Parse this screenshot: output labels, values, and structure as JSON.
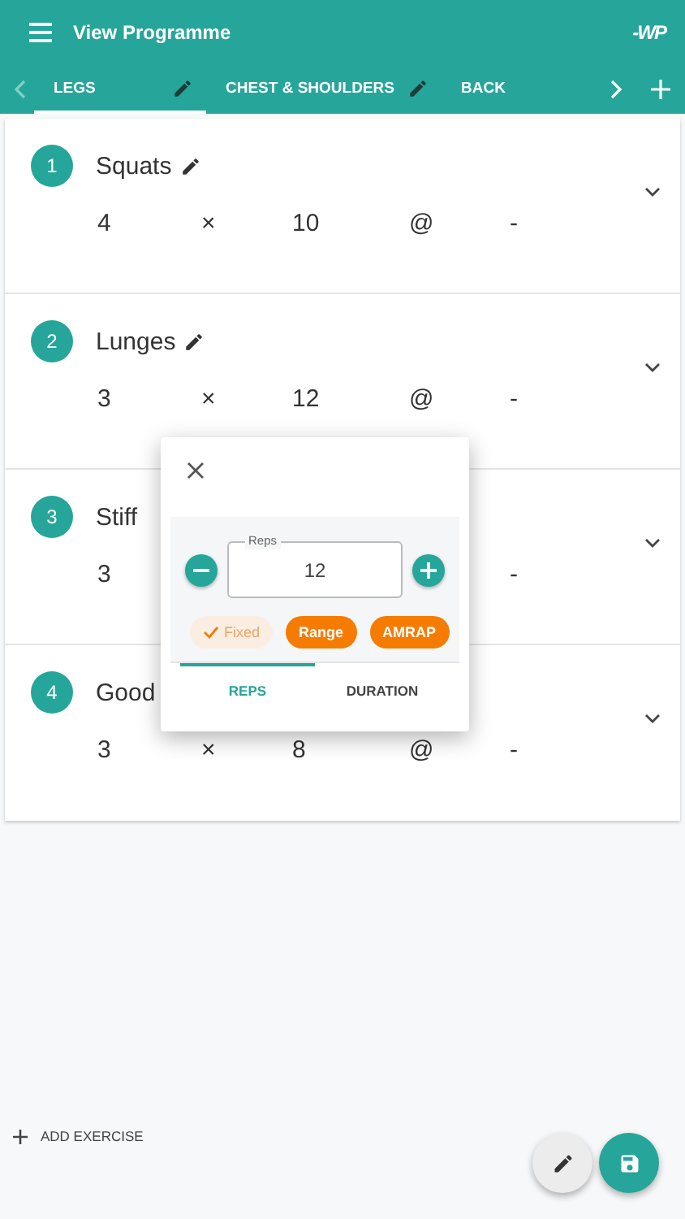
{
  "app_bar": {
    "title": "View Programme",
    "logo": "-WP"
  },
  "tabs": [
    {
      "label": "LEGS",
      "selected": true,
      "editable": true
    },
    {
      "label": "CHEST & SHOULDERS",
      "selected": false,
      "editable": true
    },
    {
      "label": "BACK",
      "selected": false,
      "editable": false
    }
  ],
  "exercises": [
    {
      "number": "1",
      "name": "Squats",
      "edit_icon": true,
      "sets": "4",
      "times": "×",
      "reps": "10",
      "at": "@",
      "weight": "-"
    },
    {
      "number": "2",
      "name": "Lunges",
      "edit_icon": true,
      "sets": "3",
      "times": "×",
      "reps": "12",
      "at": "@",
      "weight": "-"
    },
    {
      "number": "3",
      "name": "Stiff",
      "edit_icon": false,
      "sets": "3",
      "weight": "-"
    },
    {
      "number": "4",
      "name": "Good",
      "edit_icon": false,
      "sets": "3",
      "times": "×",
      "reps": "8",
      "at": "@",
      "weight": "-"
    }
  ],
  "dialog": {
    "field_label": "Reps",
    "field_value": "12",
    "modes": [
      {
        "label": "Fixed",
        "selected": true
      },
      {
        "label": "Range",
        "selected": false
      },
      {
        "label": "AMRAP",
        "selected": false
      }
    ],
    "tabs": [
      {
        "label": "REPS",
        "selected": true
      },
      {
        "label": "DURATION",
        "selected": false
      }
    ]
  },
  "add_button": "ADD EXERCISE"
}
